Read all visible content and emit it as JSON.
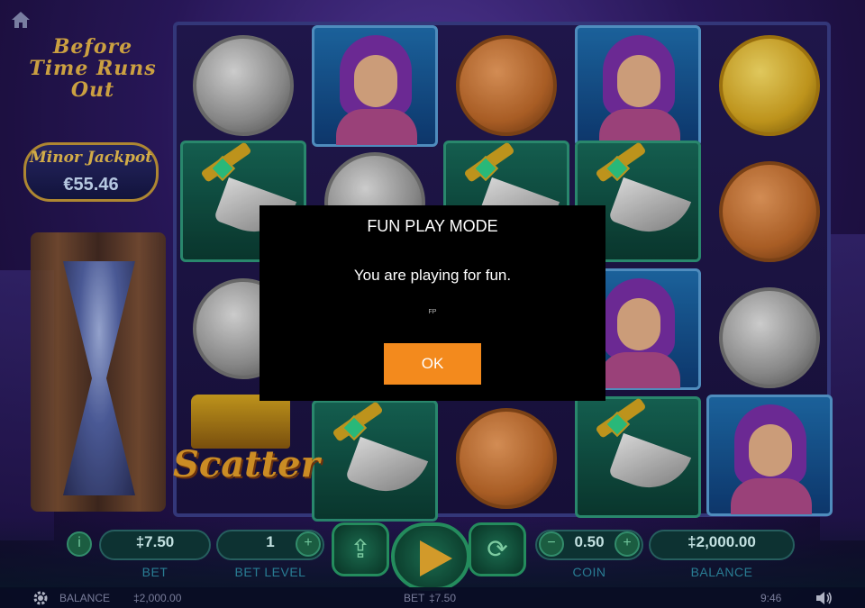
{
  "game": {
    "logo_text": "Before Time Runs Out"
  },
  "jackpot": {
    "title": "Minor Jackpot",
    "value": "€55.46"
  },
  "scatter": {
    "label": "Scatter"
  },
  "reels": [
    [
      "coin-silver",
      "dagger",
      "coin-silver",
      "scatter"
    ],
    [
      "woman",
      "coin-silver",
      "",
      "dagger"
    ],
    [
      "coin-bronze",
      "dagger",
      "",
      "coin-bronze"
    ],
    [
      "woman",
      "dagger",
      "woman",
      "dagger"
    ],
    [
      "coin-gold",
      "coin-bronze",
      "coin-silver",
      "woman"
    ]
  ],
  "modal": {
    "title": "FUN PLAY MODE",
    "message": "You are playing for fun.",
    "code": "FP",
    "ok_label": "OK"
  },
  "controls": {
    "bet_value": "‡7.50",
    "bet_label": "BET",
    "bet_level_value": "1",
    "bet_level_label": "BET LEVEL",
    "coin_value": "0.50",
    "coin_label": "COIN",
    "balance_value": "‡2,000.00",
    "balance_label": "BALANCE"
  },
  "statusbar": {
    "balance_label": "BALANCE",
    "balance_value": "‡2,000.00",
    "bet_label": "BET",
    "bet_value": "‡7.50",
    "time": "9:46"
  },
  "colors": {
    "accent": "#f38a1d",
    "modal_bg": "#000000",
    "control_label": "#2f8fa8"
  }
}
